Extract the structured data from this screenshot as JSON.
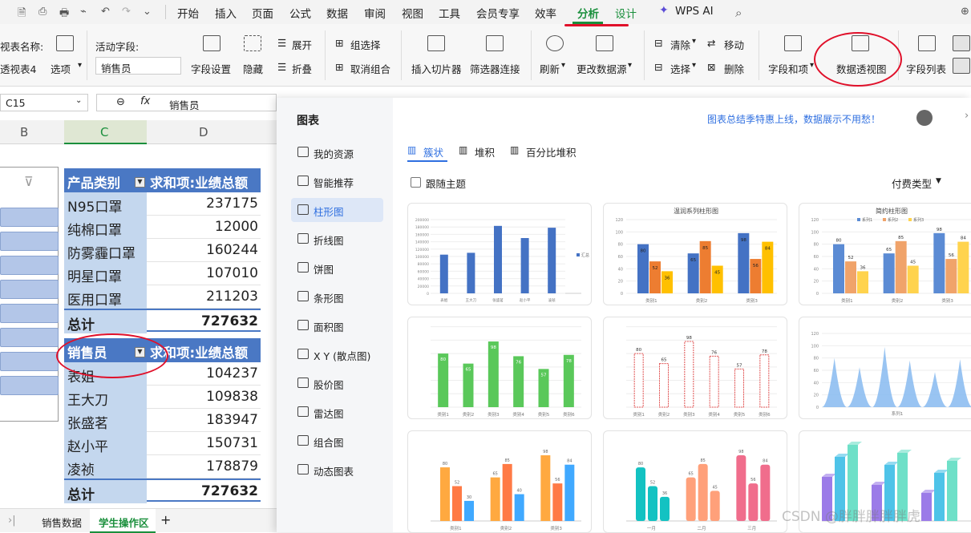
{
  "menu": {
    "items": [
      "开始",
      "插入",
      "页面",
      "公式",
      "数据",
      "审阅",
      "视图",
      "工具",
      "会员专享",
      "效率",
      "分析",
      "设计",
      "WPS AI"
    ],
    "active": "分析"
  },
  "ribbon": {
    "pivot_name_label": "视表名称:",
    "pivot_name_value": "透视表4",
    "options": "选项",
    "active_field_label": "活动字段:",
    "active_field_value": "销售员",
    "field_settings": "字段设置",
    "hide": "隐藏",
    "expand": "展开",
    "collapse": "折叠",
    "group_select": "组选择",
    "ungroup": "取消组合",
    "insert_slicer": "插入切片器",
    "filter_connect": "筛选器连接",
    "refresh": "刷新",
    "change_source": "更改数据源",
    "clear": "清除",
    "move": "移动",
    "select": "选择",
    "delete": "删除",
    "fields_items": "字段和项",
    "pivot_chart": "数据透视图",
    "field_list": "字段列表"
  },
  "namebox": "C15",
  "formula": "销售员",
  "columns": [
    "B",
    "C",
    "D"
  ],
  "pivot1": {
    "header": [
      "产品类别",
      "求和项:业绩总额"
    ],
    "rows": [
      [
        "N95口罩",
        "237175"
      ],
      [
        "纯棉口罩",
        "12000"
      ],
      [
        "防雾霾口罩",
        "160244"
      ],
      [
        "明星口罩",
        "107010"
      ],
      [
        "医用口罩",
        "211203"
      ]
    ],
    "total": [
      "总计",
      "727632"
    ]
  },
  "pivot2": {
    "header": [
      "销售员",
      "求和项:业绩总额"
    ],
    "rows": [
      [
        "表姐",
        "104237"
      ],
      [
        "王大刀",
        "109838"
      ],
      [
        "张盛茗",
        "183947"
      ],
      [
        "赵小平",
        "150731"
      ],
      [
        "凌祯",
        "178879"
      ]
    ],
    "total": [
      "总计",
      "727632"
    ]
  },
  "sheets": [
    "销售数据",
    "学生操作区"
  ],
  "active_sheet": "学生操作区",
  "panel": {
    "title": "图表",
    "promo": "图表总结季特惠上线，数据展示不用愁！",
    "nav": [
      "我的资源",
      "智能推荐",
      "柱形图",
      "折线图",
      "饼图",
      "条形图",
      "面积图",
      "X Y (散点图)",
      "股价图",
      "雷达图",
      "组合图",
      "动态图表"
    ],
    "active_nav": "柱形图",
    "tabs": [
      "簇状",
      "堆积",
      "百分比堆积"
    ],
    "follow_theme": "跟随主题",
    "pay_type": "付费类型",
    "templates": [
      {
        "title": "",
        "values": [
          105000,
          110000,
          183000,
          150000,
          178000
        ],
        "categories": [
          "表姐",
          "王大刀",
          "张盛茗",
          "赵小平",
          "凌祯"
        ],
        "legend": "汇总",
        "ylim": [
          0,
          200000
        ]
      },
      {
        "title": "温润系列柱形图",
        "categories": [
          "类别1",
          "类别2",
          "类别3"
        ],
        "series": [
          [
            80,
            65,
            98
          ],
          [
            52,
            85,
            56
          ],
          [
            36,
            45,
            84
          ]
        ],
        "ylim": [
          0,
          120
        ]
      },
      {
        "title": "简约柱形图",
        "categories": [
          "类别1",
          "类别2",
          "类别3"
        ],
        "series": [
          [
            80,
            65,
            98
          ],
          [
            52,
            85,
            56
          ],
          [
            36,
            45,
            84
          ]
        ],
        "legend": [
          "系列1",
          "系列2",
          "系列3"
        ],
        "ylim": [
          0,
          120
        ]
      },
      {
        "title": "",
        "categories": [
          "类别1",
          "类别2",
          "类别3",
          "类别4",
          "类别5",
          "类别6"
        ],
        "values": [
          80,
          65,
          98,
          76,
          57,
          78
        ]
      },
      {
        "title": "",
        "categories": [
          "类别1",
          "类别2",
          "类别3",
          "类别4",
          "类别5",
          "类别6"
        ],
        "values": [
          80,
          65,
          98,
          76,
          57,
          78
        ]
      },
      {
        "title": "",
        "categories": [
          "系列1"
        ],
        "ylim": [
          0,
          120
        ]
      },
      {
        "title": "",
        "categories": [
          "类别1",
          "类别2",
          "类别3"
        ],
        "series": [
          [
            80,
            65,
            98
          ],
          [
            52,
            85,
            56
          ],
          [
            30,
            40,
            84
          ]
        ]
      },
      {
        "title": "",
        "categories": [
          "一月",
          "二月",
          "三月"
        ],
        "series": [
          [
            80,
            65,
            98
          ],
          [
            52,
            85,
            56
          ],
          [
            36,
            45,
            84
          ]
        ]
      },
      {
        "title": "",
        "categories": []
      }
    ]
  },
  "watermark": "CSDN @胖胖胖胖胖虎",
  "colors": {
    "accent": "#1a8f3c",
    "pivot_header": "#4a78c4",
    "pivot_row": "#c4d7ee",
    "red_mark": "#e0102a"
  }
}
